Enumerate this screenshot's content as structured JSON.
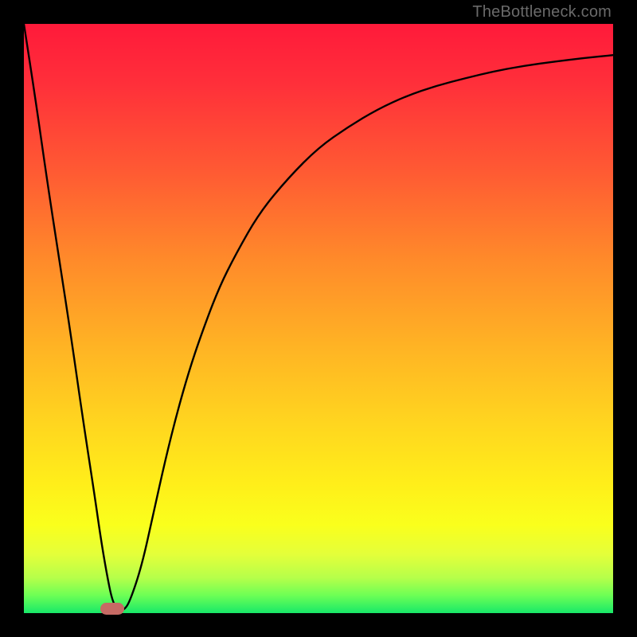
{
  "watermark": "TheBottleneck.com",
  "colors": {
    "frame": "#000000",
    "gradient_top": "#ff1a3a",
    "gradient_bottom": "#18e869",
    "curve": "#000000",
    "marker": "#c66a64",
    "watermark_text": "#6a6a6a"
  },
  "chart_data": {
    "type": "line",
    "title": "",
    "xlabel": "",
    "ylabel": "",
    "xlim": [
      0,
      100
    ],
    "ylim": [
      0,
      100
    ],
    "grid": false,
    "legend": false,
    "x": [
      0,
      2,
      4,
      6,
      8,
      10,
      12,
      13,
      14,
      15,
      16,
      17,
      18,
      20,
      22,
      24,
      26,
      28,
      30,
      33,
      36,
      40,
      45,
      50,
      55,
      60,
      65,
      70,
      75,
      80,
      85,
      90,
      95,
      100
    ],
    "values": [
      100,
      87,
      73,
      60,
      47,
      33,
      20,
      13,
      7,
      2,
      0.5,
      0.5,
      2,
      8,
      17,
      26,
      34,
      41,
      47,
      55,
      61,
      68,
      74,
      79,
      82.5,
      85.5,
      87.8,
      89.5,
      90.8,
      92,
      92.9,
      93.6,
      94.2,
      94.7
    ],
    "marker": {
      "x_start": 13,
      "x_end": 17,
      "y": 0.5
    },
    "notes": "y-values are read off the vertical extent of the curve relative to the plot area (0 = bottom/green, 100 = top/red); x is relative horizontal position 0-100. Values are estimated from pixel positions since no axis ticks are shown."
  }
}
